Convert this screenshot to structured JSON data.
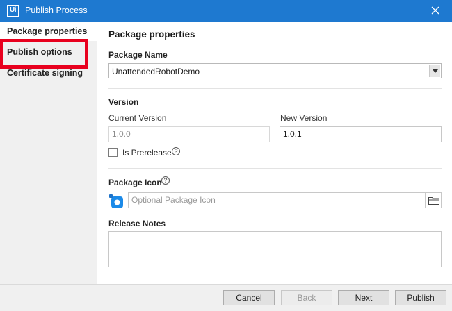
{
  "window": {
    "logo": "Ui",
    "title": "Publish Process",
    "close_icon": "close-icon"
  },
  "sidebar": {
    "items": [
      {
        "label": "Package properties",
        "selected": true
      },
      {
        "label": "Publish options",
        "selected": false,
        "highlighted": true
      },
      {
        "label": "Certificate signing",
        "selected": false
      }
    ],
    "highlight_color": "#e8001e"
  },
  "main": {
    "title": "Package properties",
    "package_name": {
      "label": "Package Name",
      "value": "UnattendedRobotDemo"
    },
    "version": {
      "label": "Version",
      "current_label": "Current Version",
      "current_value": "1.0.0",
      "new_label": "New Version",
      "new_value": "1.0.1"
    },
    "prerelease": {
      "label": "Is Prerelease",
      "checked": false,
      "help": "?"
    },
    "package_icon": {
      "label": "Package Icon",
      "help": "?",
      "placeholder": "Optional Package Icon"
    },
    "release_notes": {
      "label": "Release Notes",
      "value": ""
    }
  },
  "footer": {
    "cancel": "Cancel",
    "back": "Back",
    "next": "Next",
    "publish": "Publish"
  },
  "colors": {
    "titlebar": "#1e79d0",
    "sidebar_bg": "#f0f0f0",
    "footer_bg": "#f0f0f0"
  }
}
